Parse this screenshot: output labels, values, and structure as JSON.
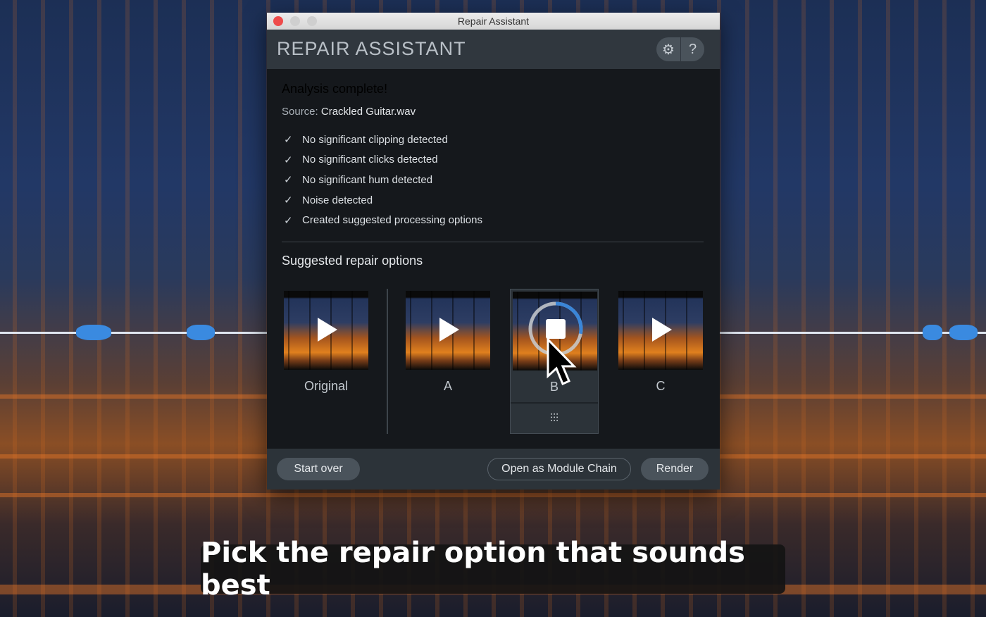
{
  "window": {
    "title": "Repair Assistant"
  },
  "header": {
    "title": "REPAIR ASSISTANT",
    "settings_icon": "gear-icon",
    "help_label": "?"
  },
  "analysis": {
    "heading": "Analysis complete!",
    "source_label": "Source:",
    "source_file": "Crackled Guitar.wav",
    "checks": [
      "No significant clipping detected",
      "No significant clicks detected",
      "No significant hum detected",
      "Noise detected",
      "Created suggested processing options"
    ]
  },
  "suggested": {
    "heading": "Suggested repair options",
    "options": [
      {
        "label": "Original",
        "state": "play"
      },
      {
        "label": "A",
        "state": "play"
      },
      {
        "label": "B",
        "state": "playing",
        "progress": 0.28,
        "selected": true
      },
      {
        "label": "C",
        "state": "play"
      }
    ]
  },
  "footer": {
    "start_over": "Start over",
    "open_chain": "Open as Module Chain",
    "render": "Render"
  },
  "caption": "Pick the repair option that sounds best",
  "colors": {
    "accent": "#3a86d8",
    "close": "#ee4b4b"
  }
}
